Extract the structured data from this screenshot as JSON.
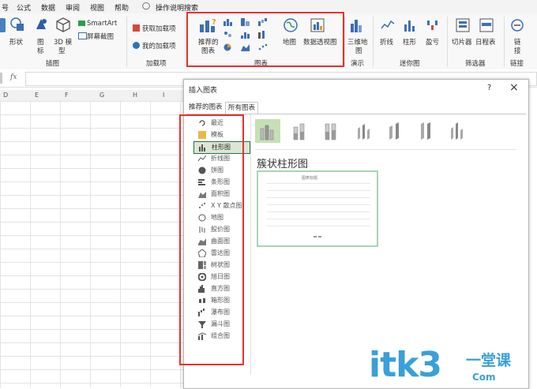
{
  "menubar": {
    "items": [
      "号",
      "公式",
      "数据",
      "审阅",
      "视图",
      "帮助"
    ],
    "search_label": "操作说明搜索"
  },
  "ribbon": {
    "illustrations": {
      "shapes": "形状",
      "icons_line1": "图",
      "icons_line2": "标",
      "model_line1": "3D 模",
      "model_line2": "型",
      "smartart": "SmartArt",
      "screenshot": "屏幕截图",
      "group": "插图"
    },
    "addins": {
      "get": "获取加载项",
      "mine": "我的加载项",
      "group": "加载项"
    },
    "charts": {
      "recommended_line1": "推荐的",
      "recommended_line2": "图表",
      "map": "地图",
      "pivot": "数据透视图",
      "group": "图表"
    },
    "tours": {
      "map3d_line1": "三维地",
      "map3d_line2": "图",
      "group": "演示"
    },
    "sparklines": {
      "line": "折线",
      "column": "柱形",
      "winloss": "盈亏",
      "group": "迷你图"
    },
    "filters": {
      "slicer": "切片器",
      "timeline": "日程表",
      "group": "筛选器"
    },
    "links": {
      "link_line1": "链",
      "link_line2": "接",
      "group": "链接"
    }
  },
  "formula_bar": {
    "fx": "fx"
  },
  "columns": [
    "D",
    "E",
    "F",
    "G",
    "H",
    "I"
  ],
  "dialog": {
    "title": "插入图表",
    "help": "?",
    "close": "×",
    "tabs": [
      "推荐的图表",
      "所有图表"
    ],
    "chart_types": [
      "最近",
      "模板",
      "柱形图",
      "折线图",
      "饼图",
      "条形图",
      "面积图",
      "X Y 散点图",
      "地图",
      "股价图",
      "曲面图",
      "雷达图",
      "树状图",
      "旭日图",
      "直方图",
      "箱形图",
      "瀑布图",
      "漏斗图",
      "组合图"
    ],
    "selected_index": 2,
    "selected_subtype_title": "簇状柱形图",
    "preview_title": "图表标题"
  },
  "watermark": {
    "text": "itk3",
    "sub1": "一堂课",
    "sub2": "Com"
  },
  "colors": {
    "accent": "#217346",
    "highlight": "#e8312f",
    "selected_bg": "#c5e0b4"
  }
}
